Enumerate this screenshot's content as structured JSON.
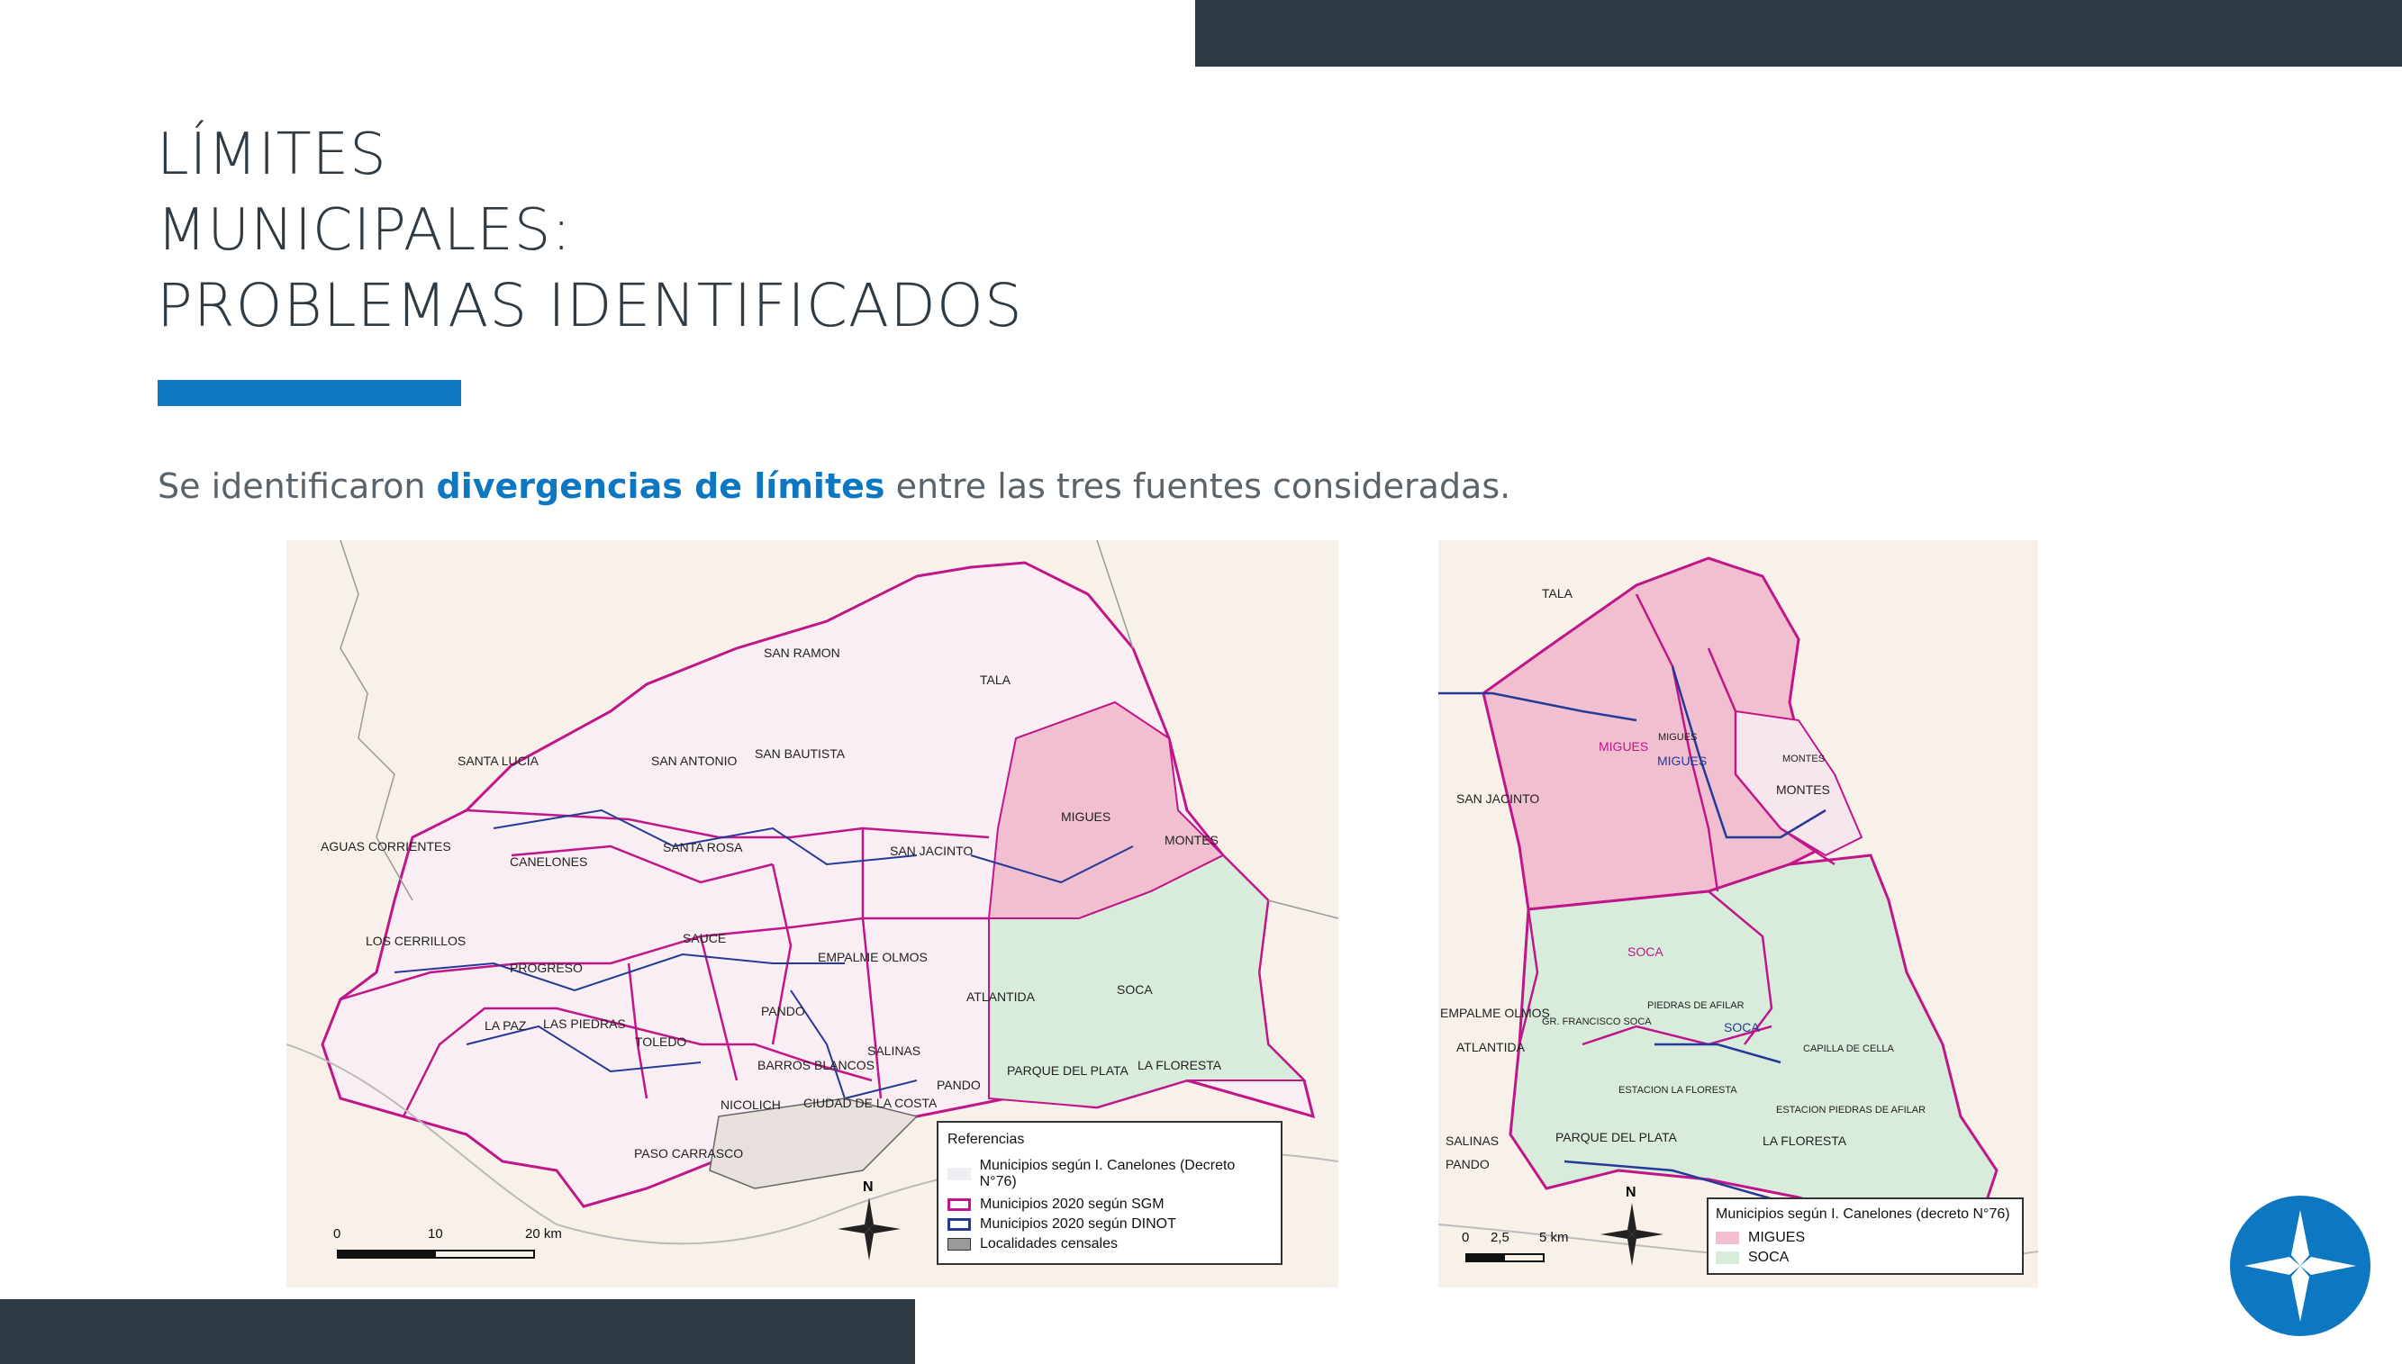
{
  "title": {
    "line1": "LÍMITES",
    "line2": "MUNICIPALES:",
    "line3": "PROBLEMAS IDENTIFICADOS"
  },
  "intro": {
    "before": "Se identificaron ",
    "highlight": "divergencias de límites",
    "after": " entre las tres fuentes consideradas."
  },
  "colors": {
    "dark_bar": "#2f3a42",
    "accent": "#0e77c1",
    "sgm_border": "#c0168a",
    "dinot_border": "#233a96",
    "miguès_fill": "#f1bfcf",
    "soca_fill": "#d8ecdc"
  },
  "map_left": {
    "places": [
      "SAN RAMON",
      "TALA",
      "SANTA LUCIA",
      "SAN ANTONIO",
      "SAN BAUTISTA",
      "AGUAS CORRIENTES",
      "CANELONES",
      "SANTA ROSA",
      "SAN JACINTO",
      "MIGUES",
      "MONTES",
      "LOS CERRILLOS",
      "SAUCE",
      "PROGRESO",
      "EMPALME OLMOS",
      "SOCA",
      "ATLANTIDA",
      "PANDO",
      "LA PAZ",
      "LAS PIEDRAS",
      "TOLEDO",
      "BARROS BLANCOS",
      "SALINAS",
      "PARQUE DEL PLATA",
      "LA FLORESTA",
      "PANDO",
      "NICOLICH",
      "CIUDAD DE LA COSTA",
      "PASO CARRASCO"
    ],
    "legend": {
      "title": "Referencias",
      "items": [
        "Municipios según I. Canelones (Decreto N°76)",
        "Municipios 2020 según SGM",
        "Municipios 2020 según DINOT",
        "Localidades censales"
      ]
    },
    "scale": [
      "0",
      "10",
      "20 km"
    ],
    "north": "N"
  },
  "map_right": {
    "places": [
      "TALA",
      "MIGUES",
      "MIGUES",
      "MIGUES",
      "MONTES",
      "MONTES",
      "SAN JACINTO",
      "SOCA",
      "SOCA",
      "PIEDRAS DE AFILAR",
      "EMPALME OLMOS",
      "GR. FRANCISCO SOCA",
      "ATLANTIDA",
      "CAPILLA DE CELLA",
      "ESTACION LA FLORESTA",
      "ESTACION PIEDRAS DE AFILAR",
      "PARQUE DEL PLATA",
      "LA FLORESTA",
      "SALINAS",
      "PANDO"
    ],
    "legend": {
      "title": "Municipios según I. Canelones (decreto N°76)",
      "items": [
        "MIGUES",
        "SOCA"
      ]
    },
    "scale": [
      "0",
      "2,5",
      "5 km"
    ],
    "north": "N"
  }
}
